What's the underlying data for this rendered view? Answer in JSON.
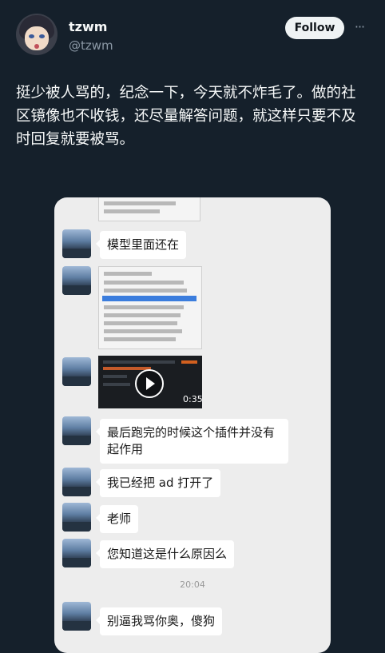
{
  "author": {
    "name": "tzwm",
    "handle": "@tzwm"
  },
  "follow_label": "Follow",
  "more_label": "···",
  "tweet_text": "挺少被人骂的，纪念一下，今天就不炸毛了。做的社区镜像也不收钱，还尽量解答问题，就这样只要不及时回复就要被骂。",
  "chat": {
    "messages": [
      {
        "text": "模型里面还在"
      },
      {
        "text": "最后跑完的时候这个插件并没有起作用"
      },
      {
        "text": "我已经把 ad 打开了"
      },
      {
        "text": "老师"
      },
      {
        "text": "您知道这是什么原因么"
      },
      {
        "text": "别逼我骂你奥，傻狗"
      }
    ],
    "video_duration": "0:35",
    "timestamp": "20:04"
  }
}
